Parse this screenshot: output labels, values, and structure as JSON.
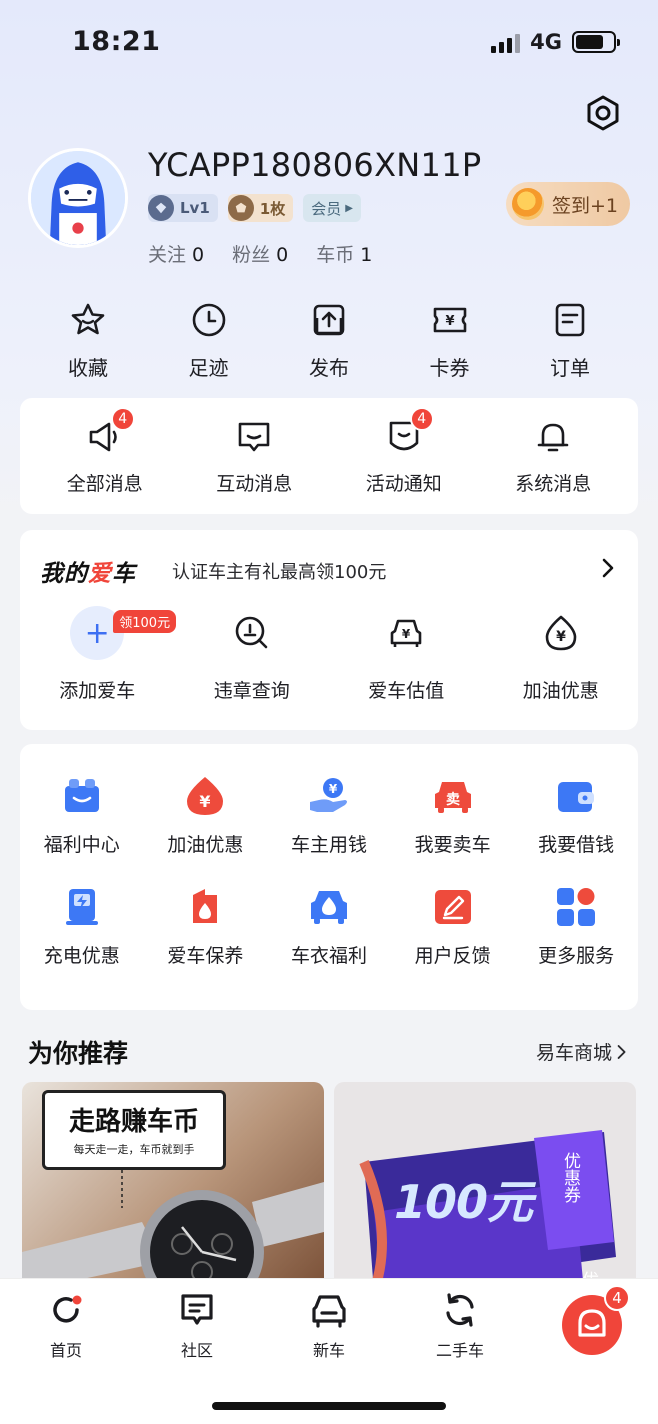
{
  "status_bar": {
    "time": "18:21",
    "network": "4G",
    "battery_percent": 75
  },
  "profile": {
    "username": "YCAPP180806XN11P",
    "level_badge": "Lv1",
    "coin_badge": "1枚",
    "vip_badge": "会员",
    "stats": [
      {
        "label": "关注",
        "value": "0"
      },
      {
        "label": "粉丝",
        "value": "0"
      },
      {
        "label": "车币",
        "value": "1"
      }
    ],
    "signin_label": "签到+1"
  },
  "quick_actions": [
    {
      "label": "收藏",
      "icon": "star-icon"
    },
    {
      "label": "足迹",
      "icon": "clock-icon"
    },
    {
      "label": "发布",
      "icon": "upload-icon"
    },
    {
      "label": "卡券",
      "icon": "coupon-icon"
    },
    {
      "label": "订单",
      "icon": "order-icon"
    }
  ],
  "messages": [
    {
      "label": "全部消息",
      "icon": "megaphone-icon",
      "badge": "4"
    },
    {
      "label": "互动消息",
      "icon": "chat-icon",
      "badge": ""
    },
    {
      "label": "活动通知",
      "icon": "activity-icon",
      "badge": "4"
    },
    {
      "label": "系统消息",
      "icon": "bell-icon",
      "badge": ""
    }
  ],
  "my_car": {
    "title_a": "我的",
    "title_b": "爱",
    "title_c": "车",
    "subtitle": "认证车主有礼最高领100元",
    "promo_tag": "领100元",
    "items": [
      {
        "label": "添加爱车",
        "icon": "add-icon"
      },
      {
        "label": "违章查询",
        "icon": "violation-search-icon"
      },
      {
        "label": "爱车估值",
        "icon": "car-valuation-icon"
      },
      {
        "label": "加油优惠",
        "icon": "fuel-drop-icon"
      }
    ]
  },
  "services": [
    {
      "label": "福利中心",
      "icon": "gift-icon"
    },
    {
      "label": "加油优惠",
      "icon": "fuel-icon"
    },
    {
      "label": "车主用钱",
      "icon": "loan-hand-icon"
    },
    {
      "label": "我要卖车",
      "icon": "sell-car-icon"
    },
    {
      "label": "我要借钱",
      "icon": "wallet-icon"
    },
    {
      "label": "充电优惠",
      "icon": "charging-icon"
    },
    {
      "label": "爱车保养",
      "icon": "maintenance-icon"
    },
    {
      "label": "车衣福利",
      "icon": "car-wash-icon"
    },
    {
      "label": "用户反馈",
      "icon": "feedback-icon"
    },
    {
      "label": "更多服务",
      "icon": "more-services-icon"
    }
  ],
  "recommend": {
    "title": "为你推荐",
    "mall_link": "易车商城",
    "cards": [
      {
        "sign_main": "走路赚车币",
        "sign_sub": "每天走一走，车币就到手"
      },
      {
        "coupon_value": "100元",
        "coupon_tag": "优惠券",
        "coupon_tag_2": "优"
      }
    ]
  },
  "tab_bar": {
    "tabs": [
      {
        "label": "首页",
        "icon": "home-icon"
      },
      {
        "label": "社区",
        "icon": "community-icon"
      },
      {
        "label": "新车",
        "icon": "new-car-icon"
      },
      {
        "label": "二手车",
        "icon": "used-car-icon"
      }
    ],
    "assistant_badge": "4"
  },
  "colors": {
    "accent_red": "#f0453a",
    "accent_blue": "#3d6ff2",
    "page_bg": "#f2f3f6"
  }
}
